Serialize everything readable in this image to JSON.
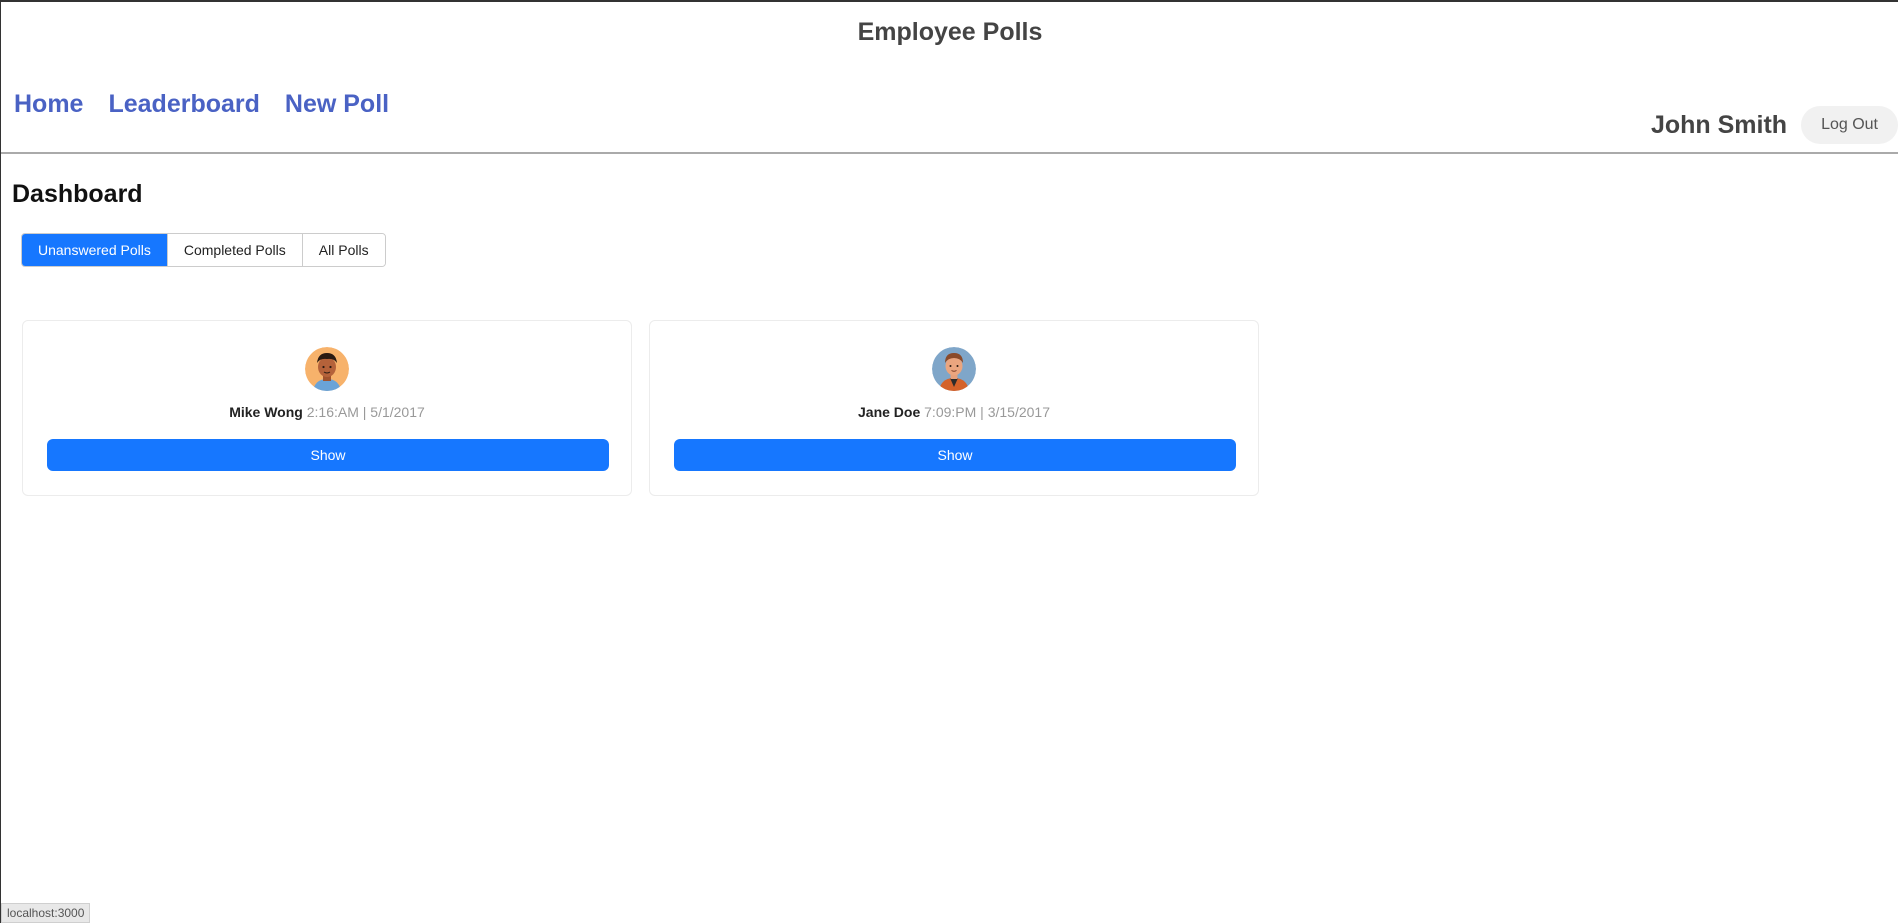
{
  "app": {
    "title": "Employee Polls"
  },
  "nav": {
    "items": [
      {
        "label": "Home"
      },
      {
        "label": "Leaderboard"
      },
      {
        "label": "New Poll"
      }
    ]
  },
  "user": {
    "name": "John Smith",
    "logout_label": "Log Out"
  },
  "page": {
    "title": "Dashboard"
  },
  "tabs": {
    "items": [
      {
        "label": "Unanswered Polls",
        "active": true
      },
      {
        "label": "Completed Polls",
        "active": false
      },
      {
        "label": "All Polls",
        "active": false
      }
    ]
  },
  "polls": [
    {
      "author": "Mike Wong",
      "timestamp": "2:16:AM | 5/1/2017",
      "button_label": "Show",
      "avatar_icon": "man-avatar-icon"
    },
    {
      "author": "Jane Doe",
      "timestamp": "7:09:PM | 3/15/2017",
      "button_label": "Show",
      "avatar_icon": "person-avatar-icon"
    }
  ],
  "status_bar": {
    "url": "localhost:3000"
  },
  "colors": {
    "primary": "#1677ff",
    "nav_link": "#4a62c4",
    "heading": "#444444"
  }
}
